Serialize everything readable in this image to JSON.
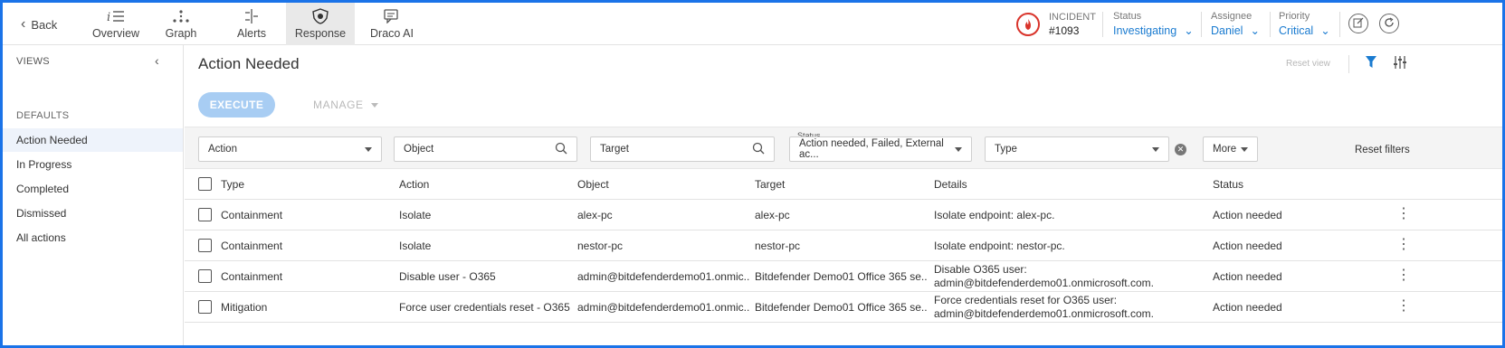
{
  "topbar": {
    "back_label": "Back",
    "tabs": [
      {
        "label": "Overview",
        "icon": "list-icon"
      },
      {
        "label": "Graph",
        "icon": "graph-icon"
      },
      {
        "label": "Alerts",
        "icon": "alerts-icon"
      },
      {
        "label": "Response",
        "icon": "response-icon",
        "active": true
      },
      {
        "label": "Draco AI",
        "icon": "chat-icon"
      }
    ],
    "incident": {
      "label": "INCIDENT",
      "number": "#1093"
    },
    "status": {
      "label": "Status",
      "value": "Investigating"
    },
    "assignee": {
      "label": "Assignee",
      "value": "Daniel"
    },
    "priority": {
      "label": "Priority",
      "value": "Critical"
    }
  },
  "sidebar": {
    "title": "VIEWS",
    "section": "DEFAULTS",
    "items": [
      {
        "label": "Action Needed",
        "active": true
      },
      {
        "label": "In Progress"
      },
      {
        "label": "Completed"
      },
      {
        "label": "Dismissed"
      },
      {
        "label": "All actions"
      }
    ]
  },
  "main": {
    "title": "Action Needed",
    "reset_view": "Reset view",
    "execute_label": "EXECUTE",
    "manage_label": "MANAGE",
    "filters": {
      "action_placeholder": "Action",
      "object_placeholder": "Object",
      "target_placeholder": "Target",
      "status_label": "Status",
      "status_value": "Action needed, Failed, External ac...",
      "type_placeholder": "Type",
      "more_label": "More",
      "reset_filters": "Reset filters"
    },
    "columns": [
      "Type",
      "Action",
      "Object",
      "Target",
      "Details",
      "Status"
    ],
    "rows": [
      {
        "type": "Containment",
        "action": "Isolate",
        "object": "alex-pc",
        "target": "alex-pc",
        "details": "Isolate endpoint: alex-pc.",
        "status": "Action needed"
      },
      {
        "type": "Containment",
        "action": "Isolate",
        "object": "nestor-pc",
        "target": "nestor-pc",
        "details": "Isolate endpoint: nestor-pc.",
        "status": "Action needed"
      },
      {
        "type": "Containment",
        "action": "Disable user - O365",
        "object": "admin@bitdefenderdemo01.onmic...",
        "target": "Bitdefender Demo01 Office 365 se...",
        "details": "Disable O365 user: admin@bitdefenderdemo01.onmicrosoft.com.",
        "status": "Action needed"
      },
      {
        "type": "Mitigation",
        "action": "Force user credentials reset - O365",
        "object": "admin@bitdefenderdemo01.onmic...",
        "target": "Bitdefender Demo01 Office 365 se...",
        "details": "Force credentials reset for O365 user: admin@bitdefenderdemo01.onmicrosoft.com.",
        "status": "Action needed"
      }
    ]
  },
  "colors": {
    "accent": "#1a7bd0",
    "execute_bg": "#a8cdf3",
    "incident_red": "#d9342b",
    "frame": "#1a73e8"
  }
}
